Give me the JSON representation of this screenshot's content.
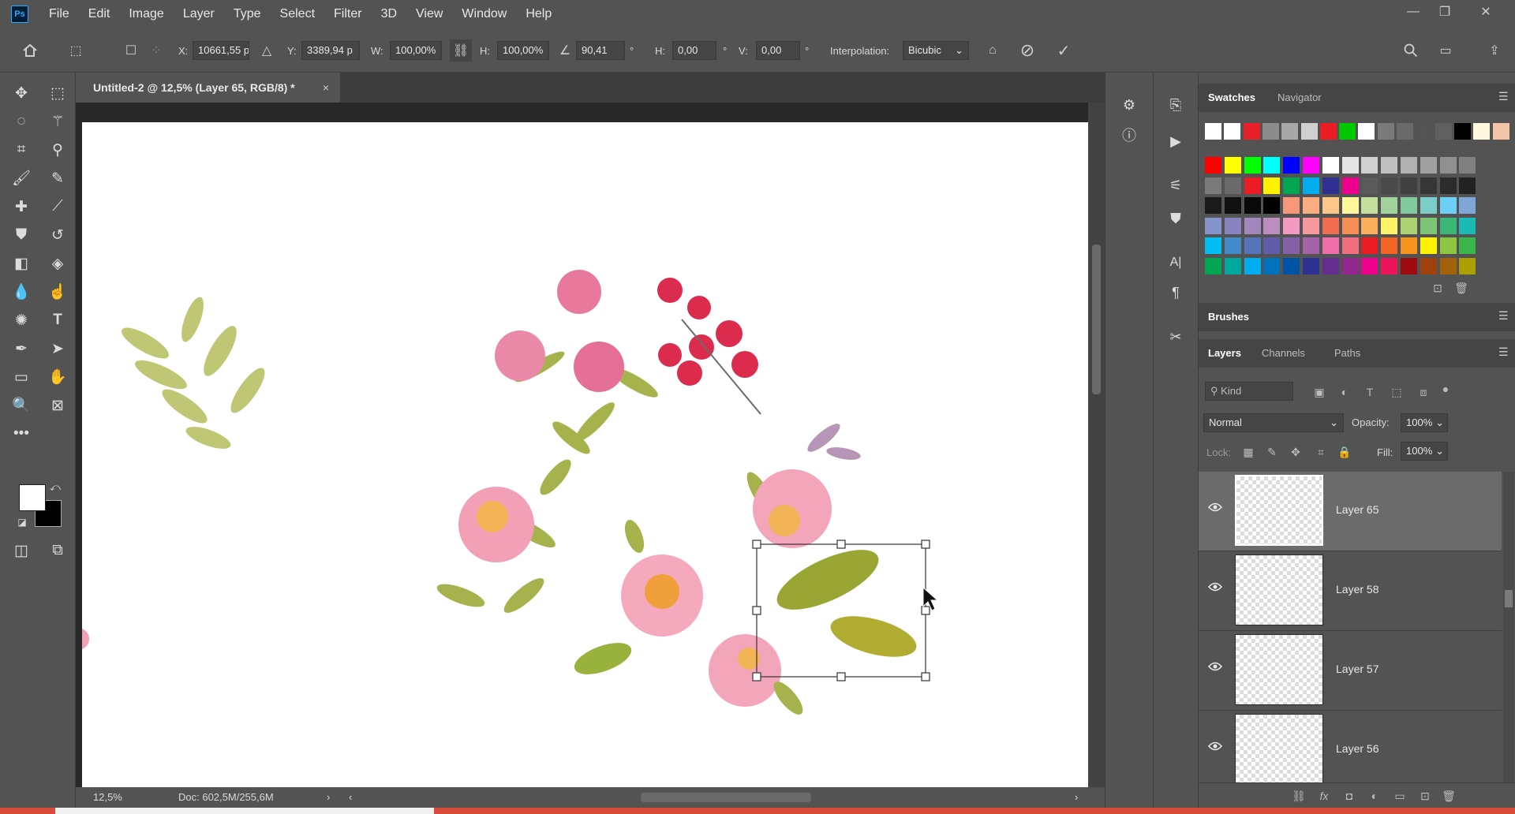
{
  "app": {
    "logo": "Ps"
  },
  "menu": [
    "File",
    "Edit",
    "Image",
    "Layer",
    "Type",
    "Select",
    "Filter",
    "3D",
    "View",
    "Window",
    "Help"
  ],
  "window_controls": {
    "minimize": "—",
    "restore": "❐",
    "close": "✕"
  },
  "options": {
    "x_label": "X:",
    "x_value": "10661,55 p",
    "y_label": "Y:",
    "y_value": "3389,94 p",
    "w_label": "W:",
    "w_value": "100,00%",
    "h_label": "H:",
    "h_value": "100,00%",
    "angle_value": "90,41",
    "deg": "°",
    "hskew_label": "H:",
    "hskew_value": "0,00",
    "vskew_label": "V:",
    "vskew_value": "0,00",
    "interp_label": "Interpolation:",
    "interp_value": "Bicubic"
  },
  "document": {
    "tab_title": "Untitled-2 @ 12,5% (Layer 65, RGB/8) *",
    "close": "×"
  },
  "status": {
    "zoom": "12,5%",
    "doc": "Doc: 602,5M/255,6M"
  },
  "panels": {
    "swatches_tab": "Swatches",
    "navigator_tab": "Navigator",
    "brushes_title": "Brushes",
    "layers_tab": "Layers",
    "channels_tab": "Channels",
    "paths_tab": "Paths",
    "kind_placeholder": "Kind",
    "blend_mode": "Normal",
    "opacity_label": "Opacity:",
    "opacity_value": "100%",
    "lock_label": "Lock:",
    "fill_label": "Fill:",
    "fill_value": "100%"
  },
  "swatch_top_row": [
    "#ffffff",
    "#ffffff",
    "#e8202c",
    "#8c8c8c",
    "#a8a8a8",
    "#d0d0d0",
    "#ed1c24",
    "#00c800",
    "#ffffff",
    "#7a7a7a",
    "#6a6a6a",
    "#545454",
    "#606060",
    "#000000",
    "#fff8e0",
    "#f2c4a8"
  ],
  "swatch_grid": [
    [
      "#ff0000",
      "#ffff00",
      "#00ff00",
      "#00ffff",
      "#0000ff",
      "#ff00ff",
      "#ffffff",
      "#e6e6e6",
      "#d0d0d0",
      "#c0c0c0",
      "#b0b0b0",
      "#a0a0a0",
      "#909090",
      "#808080"
    ],
    [
      "#7a7a7a",
      "#6a6a6a",
      "#ed1c24",
      "#fff200",
      "#00a651",
      "#00aeef",
      "#2e3192",
      "#ec008c",
      "#5a5a5a",
      "#4a4a4a",
      "#404040",
      "#363636",
      "#2c2c2c",
      "#222222"
    ],
    [
      "#1a1a1a",
      "#111111",
      "#090909",
      "#000000",
      "#f7977a",
      "#f9ad81",
      "#fdc68a",
      "#fff79a",
      "#c4df9b",
      "#a3d39c",
      "#82ca9d",
      "#7bcdc8",
      "#6ecff6",
      "#7ea7d8"
    ],
    [
      "#8493ca",
      "#8882be",
      "#a187be",
      "#bc8dbf",
      "#f49ac2",
      "#f6989d",
      "#f26c4f",
      "#f68e55",
      "#fbaf5c",
      "#fff467",
      "#acd372",
      "#7cc576",
      "#3bb878",
      "#1abbb4"
    ],
    [
      "#00bff3",
      "#438ccb",
      "#5574b9",
      "#605ca8",
      "#855fa8",
      "#a763a8",
      "#f06eaa",
      "#f26d7d",
      "#ed1c24",
      "#f26522",
      "#f7941d",
      "#fff200",
      "#8dc63f",
      "#39b54a"
    ],
    [
      "#00a651",
      "#00a99d",
      "#00aeef",
      "#0072bc",
      "#0054a6",
      "#2e3192",
      "#662d91",
      "#92278f",
      "#ec008c",
      "#ed145b",
      "#9e0b0f",
      "#a0410d",
      "#a36209",
      "#aba000"
    ]
  ],
  "layers": [
    {
      "name": "Layer 65",
      "selected": true
    },
    {
      "name": "Layer 58",
      "selected": false
    },
    {
      "name": "Layer 57",
      "selected": false
    },
    {
      "name": "Layer 56",
      "selected": false
    }
  ]
}
